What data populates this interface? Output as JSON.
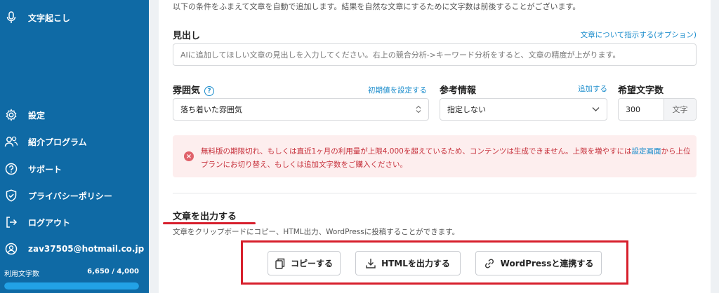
{
  "sidebar": {
    "top_item": {
      "label": "文字起こし",
      "icon": "mic-icon"
    },
    "items": [
      {
        "label": "設定",
        "icon": "gear-icon"
      },
      {
        "label": "紹介プログラム",
        "icon": "users-icon"
      },
      {
        "label": "サポート",
        "icon": "question-icon"
      },
      {
        "label": "プライバシーポリシー",
        "icon": "shield-icon"
      },
      {
        "label": "ログアウト",
        "icon": "logout-icon"
      },
      {
        "label": "zav37505@hotmail.co.jp",
        "icon": "user-icon"
      }
    ],
    "usage": {
      "label": "利用文字数",
      "value": "6,650 / 4,000",
      "fill_fraction": 1.0
    }
  },
  "form": {
    "intro": "以下の条件をふまえて文章を自動で追加します。結果を自然な文章にするために文字数は前後することがございます。",
    "heading_label": "見出し",
    "heading_link": "文章について指示する(オプション)",
    "heading_placeholder": "AIに追加してほしい文章の見出しを入力してください。右上の競合分析->キーワード分析をすると、文章の精度が上がります。",
    "mood_label": "雰囲気",
    "mood_help": "?",
    "mood_link": "初期値を設定する",
    "mood_value": "落ち着いた雰囲気",
    "ref_label": "参考情報",
    "ref_link": "追加する",
    "ref_value": "指定しない",
    "count_label": "希望文字数",
    "count_value": "300",
    "count_unit": "文字"
  },
  "alert": {
    "text_before": "無料版の期限切れ、もしくは直近1ヶ月の利用量が上限4,000を超えているため、コンテンツは生成できません。上限を増やすには",
    "link": "設定画面",
    "text_after": "から上位プランにお切り替え、もしくは追加文字数をご購入ください。",
    "color": "#c62f3a"
  },
  "output": {
    "title": "文章を出力する",
    "subtitle": "文章をクリップボードにコピー、HTML出力、WordPressに投稿することができます。",
    "copy_button": "コピーする",
    "html_button": "HTMLを出力する",
    "wp_button": "WordPressと連携する"
  },
  "colors": {
    "sidebar": "#0f6aa5",
    "accent": "#1a8ccc",
    "highlight": "#d71f2c"
  }
}
